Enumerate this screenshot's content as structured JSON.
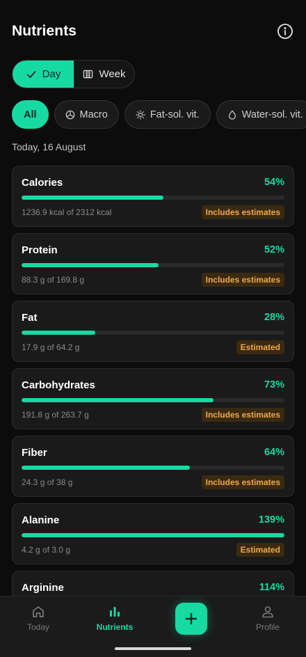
{
  "header": {
    "title": "Nutrients"
  },
  "period_toggle": {
    "day_label": "Day",
    "week_label": "Week",
    "selected": "Day"
  },
  "filters": [
    {
      "label": "All",
      "icon": "none",
      "selected": true
    },
    {
      "label": "Macro",
      "icon": "pie-chart-icon",
      "selected": false
    },
    {
      "label": "Fat-sol. vit.",
      "icon": "sun-icon",
      "selected": false
    },
    {
      "label": "Water-sol. vit.",
      "icon": "droplet-icon",
      "selected": false
    }
  ],
  "date_label": "Today, 16 August",
  "nutrients": [
    {
      "name": "Calories",
      "percent_label": "54%",
      "progress": 0.54,
      "amount": "1236.9 kcal of 2312 kcal",
      "badge": "Includes estimates"
    },
    {
      "name": "Protein",
      "percent_label": "52%",
      "progress": 0.52,
      "amount": "88.3 g of 169.8 g",
      "badge": "Includes estimates"
    },
    {
      "name": "Fat",
      "percent_label": "28%",
      "progress": 0.28,
      "amount": "17.9 g of 64.2 g",
      "badge": "Estimated"
    },
    {
      "name": "Carbohydrates",
      "percent_label": "73%",
      "progress": 0.73,
      "amount": "191.8 g of 263.7 g",
      "badge": "Includes estimates"
    },
    {
      "name": "Fiber",
      "percent_label": "64%",
      "progress": 0.64,
      "amount": "24.3 g of 38 g",
      "badge": "Includes estimates"
    },
    {
      "name": "Alanine",
      "percent_label": "139%",
      "progress": 1.0,
      "amount": "4.2 g of 3.0 g",
      "badge": "Estimated"
    },
    {
      "name": "Arginine",
      "percent_label": "114%",
      "progress": 1.0,
      "amount": "",
      "badge": ""
    }
  ],
  "bottom_nav": {
    "today_label": "Today",
    "nutrients_label": "Nutrients",
    "profile_label": "Profile",
    "active": "Nutrients"
  },
  "colors": {
    "accent": "#17d9a3",
    "background": "#0c0c0c",
    "card": "#1a1a1a",
    "badge_text": "#f0a84a",
    "badge_bg": "#3a2a12"
  }
}
